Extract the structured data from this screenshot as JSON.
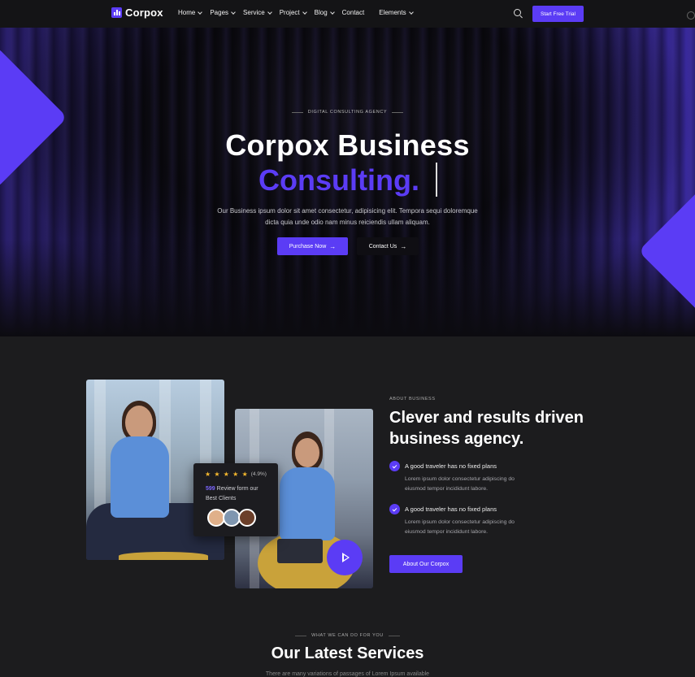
{
  "brand": {
    "name": "Corpox",
    "accent": "#5b3cf5"
  },
  "nav": {
    "items": [
      {
        "label": "Home",
        "dropdown": true
      },
      {
        "label": "Pages",
        "dropdown": true
      },
      {
        "label": "Service",
        "dropdown": true
      },
      {
        "label": "Project",
        "dropdown": true
      },
      {
        "label": "Blog",
        "dropdown": true
      },
      {
        "label": "Contact",
        "dropdown": false
      },
      {
        "label": "Elements",
        "dropdown": true
      }
    ],
    "cta": "Start Free Trial",
    "search_icon": "search-icon"
  },
  "hero": {
    "eyebrow": "DIGITAL CONSULTING AGENCY",
    "title_line1": "Corpox Business",
    "title_line2": "Consulting.",
    "description_line1": "Our Business ipsum dolor sit amet consectetur, adipisicing elit. Tempora sequi doloremque",
    "description_line2": "dicta quia unde odio nam minus reiciendis ullam aliquam.",
    "primary_button": "Purchase Now",
    "secondary_button": "Contact Us"
  },
  "review": {
    "stars": "★ ★ ★ ★ ★",
    "rating": "(4.9%)",
    "count": "599",
    "text": "Review form our Best Clients"
  },
  "about": {
    "eyebrow": "ABOUT BUSINESS",
    "title": "Clever and results driven business agency.",
    "features": [
      {
        "title": "A good traveler has no fixed plans",
        "desc": "Lorem ipsum dolor consectetur adipiscing do eiusmod tempor incididunt labore."
      },
      {
        "title": "A good traveler has no fixed plans",
        "desc": "Lorem ipsum dolor consectetur adipiscing do eiusmod tempor incididunt labore."
      }
    ],
    "button": "About Our Corpox"
  },
  "services": {
    "eyebrow": "WHAT WE CAN DO FOR YOU",
    "title": "Our Latest Services",
    "subtitle": "There are many variations of passages of Lorem Ipsum available"
  }
}
